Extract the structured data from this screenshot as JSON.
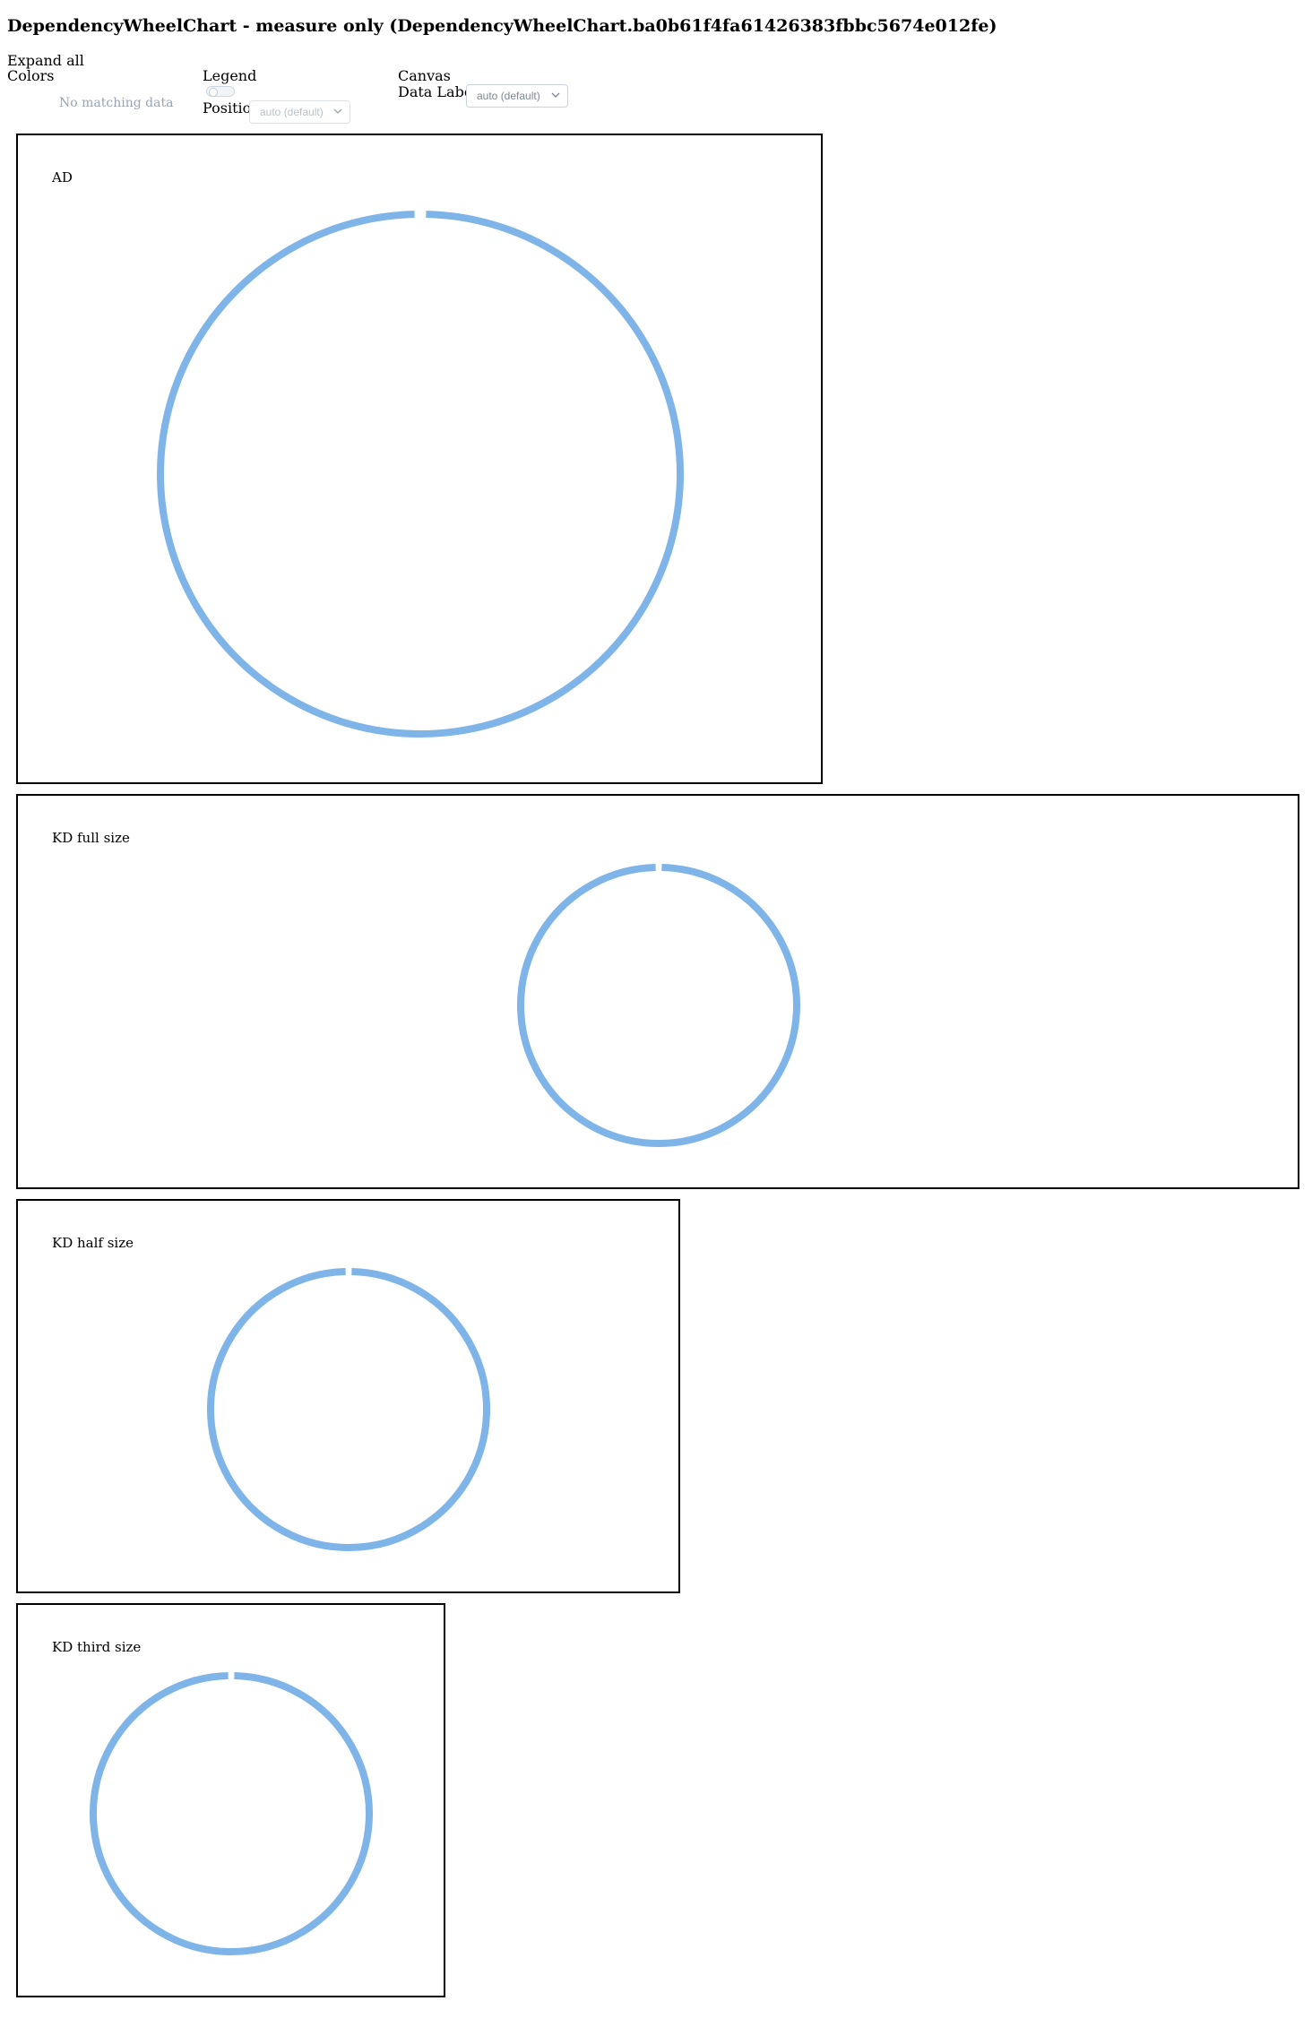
{
  "page": {
    "title": "DependencyWheelChart - measure only (DependencyWheelChart.ba0b61f4fa61426383fbbc5674e012fe)"
  },
  "controls": {
    "expand_all": "Expand all",
    "colors": {
      "label": "Colors",
      "empty_text": "No matching data"
    },
    "legend": {
      "label": "Legend",
      "toggle_on": false,
      "position_label": "Position",
      "position_value": "auto (default)"
    },
    "canvas": {
      "label": "Canvas",
      "data_labels_label": "Data Labels",
      "data_labels_value": "auto (default)"
    }
  },
  "charts": [
    {
      "label": "AD"
    },
    {
      "label": "KD full size"
    },
    {
      "label": "KD half size"
    },
    {
      "label": "KD third size"
    }
  ],
  "style": {
    "ring_color": "#7eb4e8"
  },
  "chart_data": [
    {
      "type": "dependency-wheel",
      "title": "AD",
      "nodes": [],
      "links": []
    },
    {
      "type": "dependency-wheel",
      "title": "KD full size",
      "nodes": [],
      "links": []
    },
    {
      "type": "dependency-wheel",
      "title": "KD half size",
      "nodes": [],
      "links": []
    },
    {
      "type": "dependency-wheel",
      "title": "KD third size",
      "nodes": [],
      "links": []
    }
  ]
}
